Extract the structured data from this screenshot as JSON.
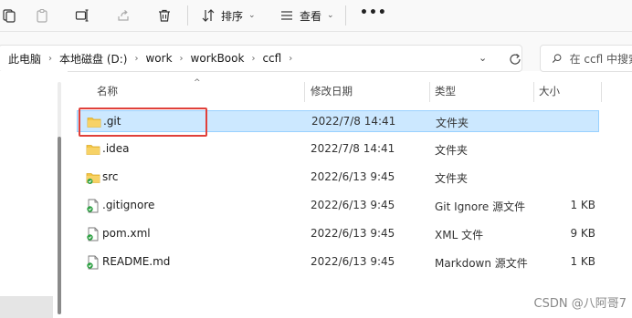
{
  "toolbar": {
    "icons": [
      "copy-icon",
      "paste-icon",
      "rename-icon",
      "share-icon",
      "delete-icon"
    ],
    "sort_label": "排序",
    "view_label": "查看",
    "more_label": "•••"
  },
  "breadcrumb": {
    "items": [
      "此电脑",
      "本地磁盘 (D:)",
      "work",
      "workBook",
      "ccfl"
    ]
  },
  "search": {
    "placeholder": "在 ccfl 中搜索"
  },
  "columns": {
    "name": "名称",
    "modified": "修改日期",
    "type": "类型",
    "size": "大小"
  },
  "files": [
    {
      "name": ".git",
      "modified": "2022/7/8 14:41",
      "type": "文件夹",
      "size": "",
      "icon": "folder-icon",
      "selected": true
    },
    {
      "name": ".idea",
      "modified": "2022/7/8 14:41",
      "type": "文件夹",
      "size": "",
      "icon": "folder-icon"
    },
    {
      "name": "src",
      "modified": "2022/6/13 9:45",
      "type": "文件夹",
      "size": "",
      "icon": "folder-git-icon"
    },
    {
      "name": ".gitignore",
      "modified": "2022/6/13 9:45",
      "type": "Git Ignore 源文件",
      "size": "1 KB",
      "icon": "git-file-icon"
    },
    {
      "name": "pom.xml",
      "modified": "2022/6/13 9:45",
      "type": "XML 文件",
      "size": "9 KB",
      "icon": "git-file-icon"
    },
    {
      "name": "README.md",
      "modified": "2022/6/13 9:45",
      "type": "Markdown 源文件",
      "size": "1 KB",
      "icon": "git-file-icon"
    }
  ],
  "watermark": "CSDN @八阿哥7",
  "colors": {
    "selection_bg": "#cce8ff",
    "selection_border": "#99d1ff",
    "highlight_red": "#e0403a",
    "folder_yellow": "#f4c542"
  }
}
